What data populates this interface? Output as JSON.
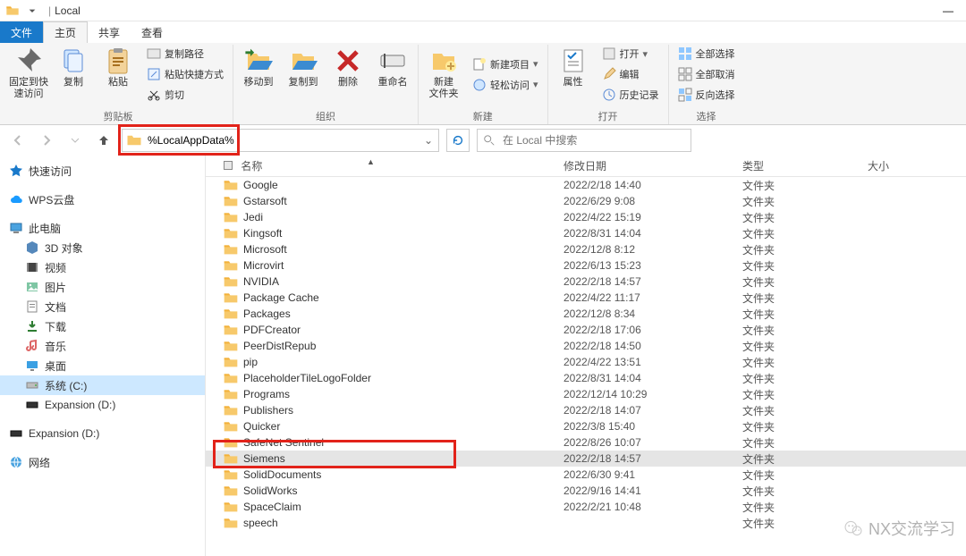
{
  "titlebar": {
    "quick_up": "↑",
    "sep": "|",
    "title": "Local"
  },
  "tabs": {
    "file": "文件",
    "home": "主页",
    "share": "共享",
    "view": "查看"
  },
  "ribbon": {
    "clipboard": {
      "pin": "固定到快\n速访问",
      "copy": "复制",
      "paste": "粘贴",
      "copy_path": "复制路径",
      "paste_shortcut": "粘贴快捷方式",
      "cut": "剪切",
      "label": "剪贴板"
    },
    "organize": {
      "move_to": "移动到",
      "copy_to": "复制到",
      "delete": "删除",
      "rename": "重命名",
      "label": "组织"
    },
    "new": {
      "new_folder": "新建\n文件夹",
      "new_item": "新建项目",
      "easy_access": "轻松访问",
      "label": "新建"
    },
    "open": {
      "properties": "属性",
      "open": "打开",
      "edit": "编辑",
      "history": "历史记录",
      "label": "打开"
    },
    "select": {
      "select_all": "全部选择",
      "select_none": "全部取消",
      "invert": "反向选择",
      "label": "选择"
    }
  },
  "address": {
    "value": "%LocalAppData%"
  },
  "search": {
    "placeholder": "在 Local 中搜索"
  },
  "nav": {
    "quick_access": "快速访问",
    "wps": "WPS云盘",
    "this_pc": "此电脑",
    "objects_3d": "3D 对象",
    "videos": "视频",
    "pictures": "图片",
    "documents": "文档",
    "downloads": "下载",
    "music": "音乐",
    "desktop": "桌面",
    "system_c": "系统 (C:)",
    "expansion_d1": "Expansion (D:)",
    "expansion_d2": "Expansion (D:)",
    "network": "网络"
  },
  "columns": {
    "name": "名称",
    "date": "修改日期",
    "type": "类型",
    "size": "大小"
  },
  "type_folder": "文件夹",
  "files": [
    {
      "name": "Google",
      "date": "2022/2/18 14:40"
    },
    {
      "name": "Gstarsoft",
      "date": "2022/6/29 9:08"
    },
    {
      "name": "Jedi",
      "date": "2022/4/22 15:19"
    },
    {
      "name": "Kingsoft",
      "date": "2022/8/31 14:04"
    },
    {
      "name": "Microsoft",
      "date": "2022/12/8 8:12"
    },
    {
      "name": "Microvirt",
      "date": "2022/6/13 15:23"
    },
    {
      "name": "NVIDIA",
      "date": "2022/2/18 14:57"
    },
    {
      "name": "Package Cache",
      "date": "2022/4/22 11:17"
    },
    {
      "name": "Packages",
      "date": "2022/12/8 8:34"
    },
    {
      "name": "PDFCreator",
      "date": "2022/2/18 17:06"
    },
    {
      "name": "PeerDistRepub",
      "date": "2022/2/18 14:50"
    },
    {
      "name": "pip",
      "date": "2022/4/22 13:51"
    },
    {
      "name": "PlaceholderTileLogoFolder",
      "date": "2022/8/31 14:04"
    },
    {
      "name": "Programs",
      "date": "2022/12/14 10:29"
    },
    {
      "name": "Publishers",
      "date": "2022/2/18 14:07"
    },
    {
      "name": "Quicker",
      "date": "2022/3/8 15:40"
    },
    {
      "name": "SafeNet Sentinel",
      "date": "2022/8/26 10:07"
    },
    {
      "name": "Siemens",
      "date": "2022/2/18 14:57",
      "selected": true
    },
    {
      "name": "SolidDocuments",
      "date": "2022/6/30 9:41"
    },
    {
      "name": "SolidWorks",
      "date": "2022/9/16 14:41"
    },
    {
      "name": "SpaceClaim",
      "date": "2022/2/21 10:48"
    },
    {
      "name": "speech",
      "date": ""
    }
  ],
  "watermark": {
    "text": "NX交流学习"
  }
}
